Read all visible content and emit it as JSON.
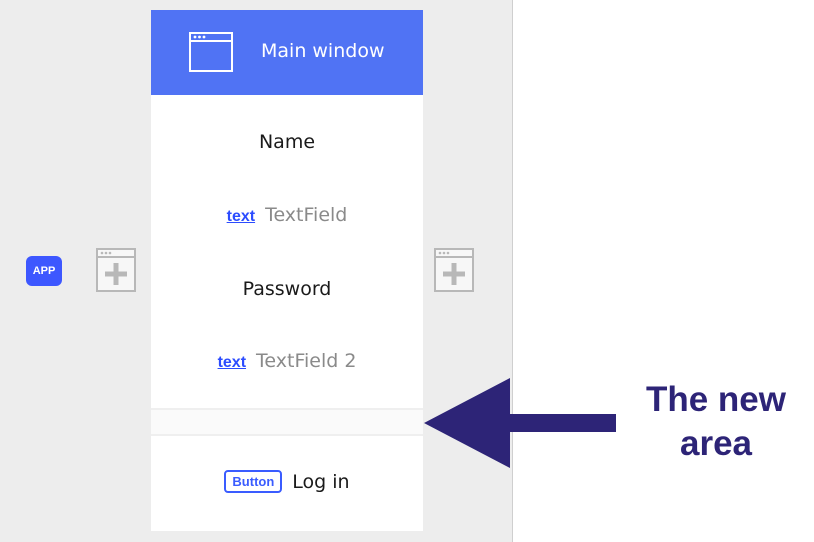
{
  "app_badge": {
    "label": "APP"
  },
  "main_window": {
    "title": "Main window",
    "name_label": "Name",
    "text_field_1": {
      "tag": "text",
      "name": "TextField"
    },
    "password_label": "Password",
    "text_field_2": {
      "tag": "text",
      "name": "TextField 2"
    },
    "button": {
      "tag": "Button",
      "label": "Log in"
    }
  },
  "annotation": {
    "line1": "The new",
    "line2": "area"
  },
  "colors": {
    "header": "#5073f4",
    "accent": "#3d57ff",
    "annotation": "#2d2477",
    "canvas": "#ededed"
  },
  "icons": {
    "add_window": "add-window-icon",
    "window": "window-icon",
    "arrow": "arrow-left-icon"
  }
}
